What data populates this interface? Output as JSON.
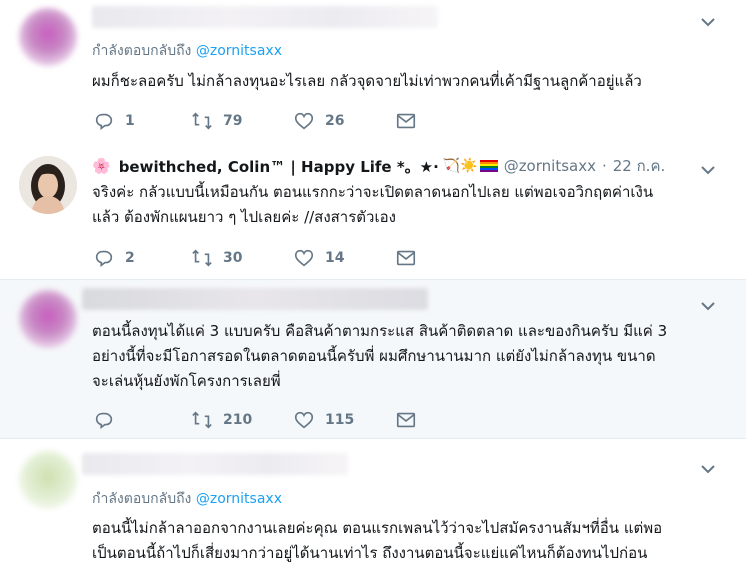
{
  "colors": {
    "link": "#1da1f2",
    "muted": "#657786",
    "text": "#14171a",
    "highlight_bg": "#f5f8fa"
  },
  "tweets": [
    {
      "reply_prefix": "กำลังตอบกลับถึง",
      "reply_handle": "@zornitsaxx",
      "lines": [
        "ผมก็ชะลอครับ ไม่กล้าลงทุนอะไรเลย กลัวจุดจายไม่เท่าพวกคนที่เค้ามีฐานลูกค้าอยู่แล้ว"
      ],
      "replies": "1",
      "retweets": "79",
      "likes": "26"
    },
    {
      "display_name": "bewithched, Colin™ | Happy Life *。★·",
      "handle": "@zornitsaxx",
      "dot": "·",
      "time": "22 ก.ค.",
      "lines": [
        "จริงค่ะ กลัวแบบนี้เหมือนกัน ตอนแรกกะว่าจะเปิดตลาดนอกไปเลย แต่พอเจอวิกฤตค่าเงิน",
        "แล้ว ต้องพักแผนยาว ๆ ไปเลยค่ะ //สงสารตัวเอง"
      ],
      "replies": "2",
      "retweets": "30",
      "likes": "14"
    },
    {
      "lines": [
        "ตอนนี้ลงทุนได้แค่ 3 แบบครับ คือสินค้าตามกระแส สินค้าติดตลาด และของกินครับ มีแค่ 3",
        "อย่างนี้ที่จะมีโอกาสรอดในตลาดตอนนี้ครับพี่ ผมศึกษานานมาก แต่ยังไม่กล้าลงทุน ขนาด",
        "จะเล่นหุ้นยังพักโครงการเลยพี่"
      ],
      "replies": "",
      "retweets": "210",
      "likes": "115"
    },
    {
      "reply_prefix": "กำลังตอบกลับถึง",
      "reply_handle": "@zornitsaxx",
      "lines": [
        "ตอนนี้ไม่กล้าลาออกจากงานเลยค่ะคุณ ตอนแรกเพลนไว้ว่าจะไปสมัครงานสัมฯที่อื่น แต่พอ",
        "เป็นตอนนี้ถ้าไปก็เสี่ยงมากว่าอยู่ได้นานเท่าไร ถึงงานตอนนี้จะแย่แค่ไหนก็ต้องทนไปก่อน"
      ]
    }
  ]
}
